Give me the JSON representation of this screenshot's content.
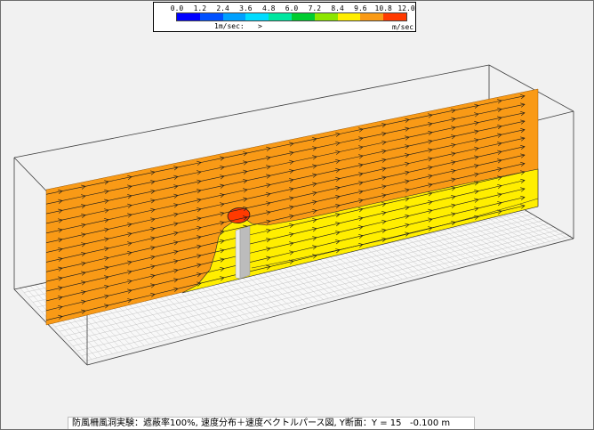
{
  "chart_data": {
    "type": "heatmap",
    "title": "防風柵風洞実験：遮蔽率100%, 速度分布＋速度ベクトルパース図, Y断面：Y = 15   -0.100 m",
    "colorbar": {
      "range": [
        0.0,
        12.0
      ],
      "ticks": [
        0.0,
        1.2,
        2.4,
        3.6,
        4.8,
        6.0,
        7.2,
        8.4,
        9.6,
        10.8,
        12.0
      ],
      "tick_labels": [
        "0.0",
        "1.2",
        "2.4",
        "3.6",
        "4.8",
        "6.0",
        "7.2",
        "8.4",
        "9.6",
        "10.8",
        "12.0"
      ],
      "bin_colors": [
        "#0000ff",
        "#0050ff",
        "#00a0ff",
        "#00dcff",
        "#00e6a0",
        "#00cc30",
        "#8ce600",
        "#ffee00",
        "#f99a16",
        "#ff3a00"
      ],
      "unit": "m/sec",
      "placement": "top-center"
    },
    "vector_reference": {
      "label": "1m/sec:",
      "symbol": ">"
    },
    "section_bands": [
      {
        "min": 9.6,
        "max": 10.8,
        "color": "#f99a16"
      },
      {
        "min": 8.4,
        "max": 9.6,
        "color": "#ffee00"
      },
      {
        "min": 10.8,
        "max": 12.0,
        "color": "#ff3a00"
      }
    ],
    "grid": true
  }
}
